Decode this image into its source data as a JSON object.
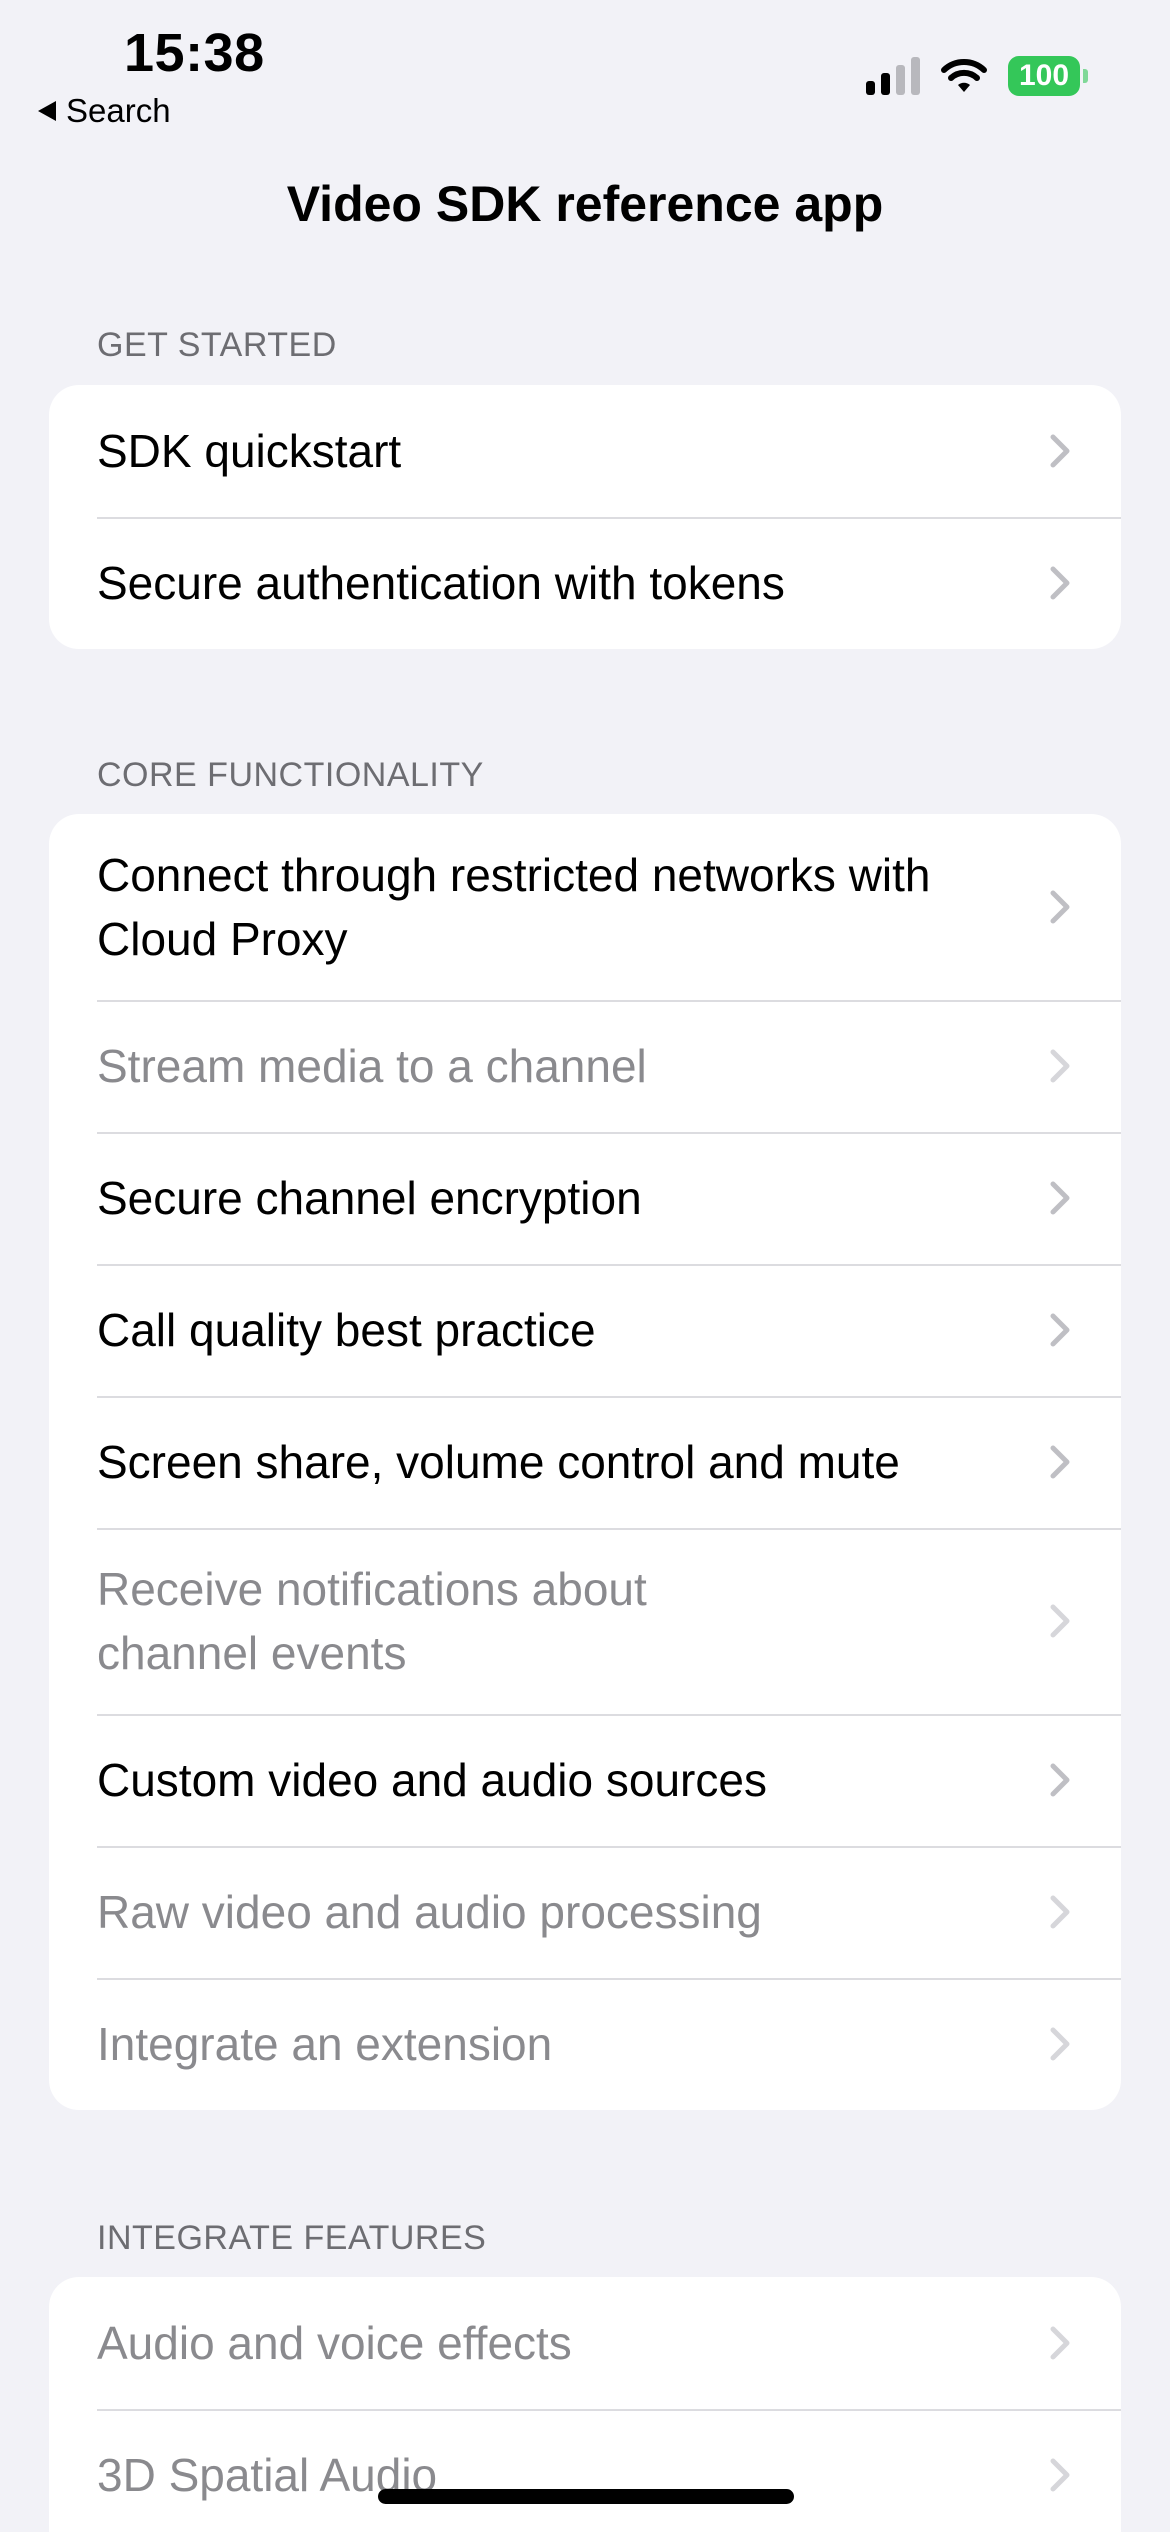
{
  "status_bar": {
    "time": "15:38",
    "back_label": "Search",
    "battery": "100"
  },
  "nav": {
    "title": "Video SDK reference app"
  },
  "sections": [
    {
      "header": "GET STARTED",
      "items": [
        {
          "label": "SDK quickstart",
          "enabled": true
        },
        {
          "label": "Secure authentication with tokens",
          "enabled": true
        }
      ]
    },
    {
      "header": "CORE FUNCTIONALITY",
      "items": [
        {
          "label": "Connect through restricted networks with Cloud Proxy",
          "enabled": true
        },
        {
          "label": "Stream media to a channel",
          "enabled": false
        },
        {
          "label": "Secure channel encryption",
          "enabled": true
        },
        {
          "label": "Call quality best practice",
          "enabled": true
        },
        {
          "label": "Screen share, volume control and mute",
          "enabled": true
        },
        {
          "label": "Receive notifications about channel events",
          "enabled": false
        },
        {
          "label": "Custom video and audio sources",
          "enabled": true
        },
        {
          "label": "Raw video and audio processing",
          "enabled": false
        },
        {
          "label": "Integrate an extension",
          "enabled": false
        }
      ]
    },
    {
      "header": "INTEGRATE FEATURES",
      "items": [
        {
          "label": "Audio and voice effects",
          "enabled": false
        },
        {
          "label": "3D Spatial Audio",
          "enabled": false
        }
      ]
    }
  ],
  "colors": {
    "background": "#f2f2f7",
    "disabled_text": "#8a8a8e",
    "battery_green": "#34c759"
  }
}
